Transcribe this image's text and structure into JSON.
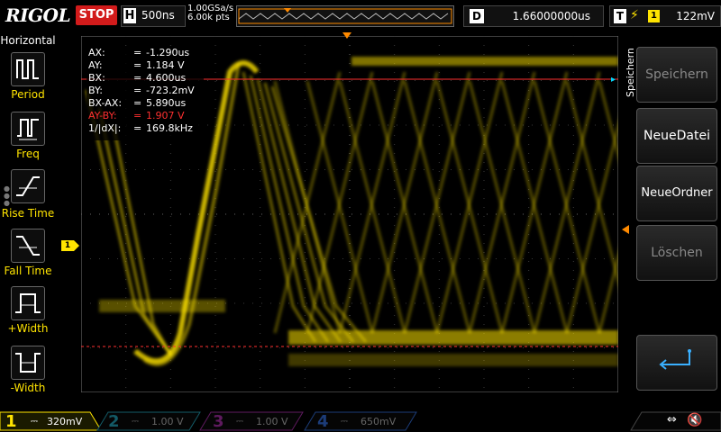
{
  "header": {
    "logo": "RIGOL",
    "run_state": "STOP",
    "timebase_label": "H",
    "timebase_value": "500ns",
    "sample_rate": "1.00GSa/s",
    "memory_depth": "6.00k pts",
    "delay_label": "D",
    "delay_value": "1.66000000us",
    "trigger_label": "T",
    "trigger_edge": "rising-edge-icon",
    "trigger_source": "1",
    "trigger_level": "122mV"
  },
  "left_menu": {
    "title": "Horizontal",
    "items": [
      {
        "label": "Period",
        "icon": "period-icon"
      },
      {
        "label": "Freq",
        "icon": "freq-icon"
      },
      {
        "label": "Rise Time",
        "icon": "rise-time-icon"
      },
      {
        "label": "Fall Time",
        "icon": "fall-time-icon"
      },
      {
        "label": "+Width",
        "icon": "positive-width-icon"
      },
      {
        "label": "-Width",
        "icon": "negative-width-icon"
      }
    ]
  },
  "cursor": {
    "rows": [
      {
        "key": "AX:",
        "eq": "=",
        "value": "-1.290us"
      },
      {
        "key": "AY:",
        "eq": "=",
        "value": "1.184 V"
      },
      {
        "key": "BX:",
        "eq": "=",
        "value": "4.600us"
      },
      {
        "key": "BY:",
        "eq": "=",
        "value": "-723.2mV"
      },
      {
        "key": "BX-AX:",
        "eq": "=",
        "value": "5.890us"
      },
      {
        "key": "AY-BY:",
        "eq": "=",
        "value": "1.907 V"
      },
      {
        "key": "1/|dX|:",
        "eq": "=",
        "value": "169.8kHz"
      }
    ]
  },
  "right_menu": {
    "title": "Speichern",
    "buttons": [
      {
        "label": "Speichern",
        "enabled": false
      },
      {
        "label": "NeueDatei",
        "enabled": true
      },
      {
        "label": "NeueOrdner",
        "enabled": true
      },
      {
        "label": "Löschen",
        "enabled": false
      },
      {
        "label": "",
        "icon": "return-arrow-icon",
        "enabled": true
      }
    ]
  },
  "channel1_marker": "1",
  "channels": [
    {
      "num": "1",
      "value": "320mV",
      "color": "#ffe400",
      "active": true
    },
    {
      "num": "2",
      "value": "1.00 V",
      "color": "#00b4d2",
      "active": false
    },
    {
      "num": "3",
      "value": "1.00 V",
      "color": "#c832c8",
      "active": false
    },
    {
      "num": "4",
      "value": "650mV",
      "color": "#2a6cd8",
      "active": false
    }
  ],
  "colors": {
    "trace": "#ffe400",
    "cursor": "#ff3030",
    "trigger": "#ff8a00",
    "stop": "#d21b1b"
  }
}
